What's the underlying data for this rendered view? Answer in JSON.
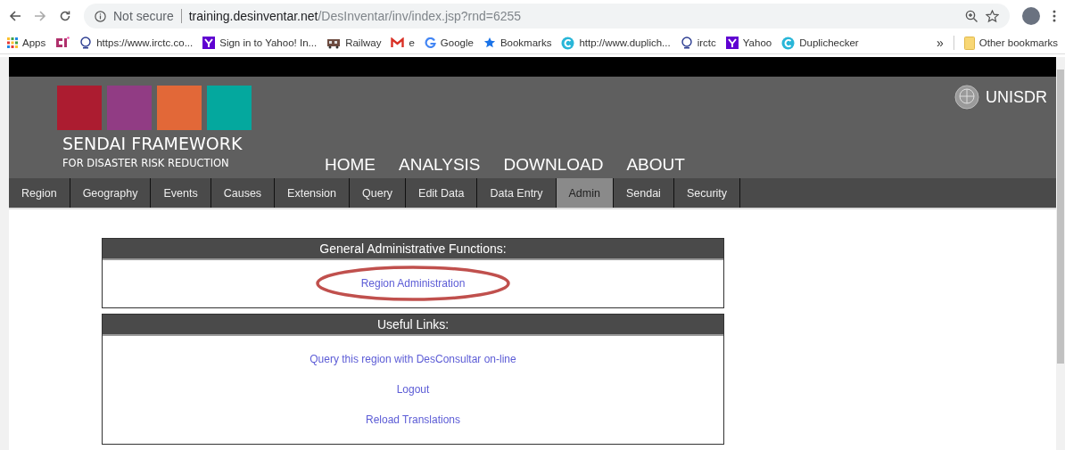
{
  "browser": {
    "security": "Not secure",
    "url_host": "training.desinventar.net",
    "url_path": "/DesInventar/inv/index.jsp?rnd=6255"
  },
  "bookmarks": [
    {
      "label": "Apps",
      "kind": "apps"
    },
    {
      "kind": "ci"
    },
    {
      "label": "https://www.irctc.co...",
      "kind": "irctc"
    },
    {
      "label": "Sign in to Yahoo! In...",
      "kind": "yahoo"
    },
    {
      "label": "Railway",
      "kind": "train"
    },
    {
      "label": "e",
      "kind": "gmail"
    },
    {
      "label": "Google",
      "kind": "google"
    },
    {
      "label": "Bookmarks",
      "kind": "star"
    },
    {
      "label": "http://www.duplich...",
      "kind": "dup"
    },
    {
      "label": "irctc",
      "kind": "irctc"
    },
    {
      "label": "Yahoo",
      "kind": "yahoo"
    },
    {
      "label": "Duplichecker",
      "kind": "dup"
    }
  ],
  "overflow": "»",
  "other_bookmarks": "Other bookmarks",
  "header": {
    "logo_title": "SENDAI FRAMEWORK",
    "logo_subtitle": "FOR DISASTER RISK REDUCTION",
    "org": "UNISDR",
    "menu": [
      "HOME",
      "ANALYSIS",
      "DOWNLOAD",
      "ABOUT"
    ]
  },
  "tabs": [
    {
      "label": "Region",
      "selected": false
    },
    {
      "label": "Geography",
      "selected": false
    },
    {
      "label": "Events",
      "selected": false
    },
    {
      "label": "Causes",
      "selected": false
    },
    {
      "label": "Extension",
      "selected": false
    },
    {
      "label": "Query",
      "selected": false
    },
    {
      "label": "Edit Data",
      "selected": false
    },
    {
      "label": "Data Entry",
      "selected": false
    },
    {
      "label": "Admin",
      "selected": true
    },
    {
      "label": "Sendai",
      "selected": false
    },
    {
      "label": "Security",
      "selected": false
    }
  ],
  "panels": [
    {
      "title": "General Administrative Functions:",
      "links": [
        {
          "label": "Region Administration",
          "circled": true
        }
      ]
    },
    {
      "title": "Useful Links:",
      "links": [
        {
          "label": "Query this region with DesConsultar on-line",
          "circled": false
        },
        {
          "label": "Logout",
          "circled": false
        },
        {
          "label": "Reload Translations",
          "circled": false
        }
      ]
    }
  ]
}
